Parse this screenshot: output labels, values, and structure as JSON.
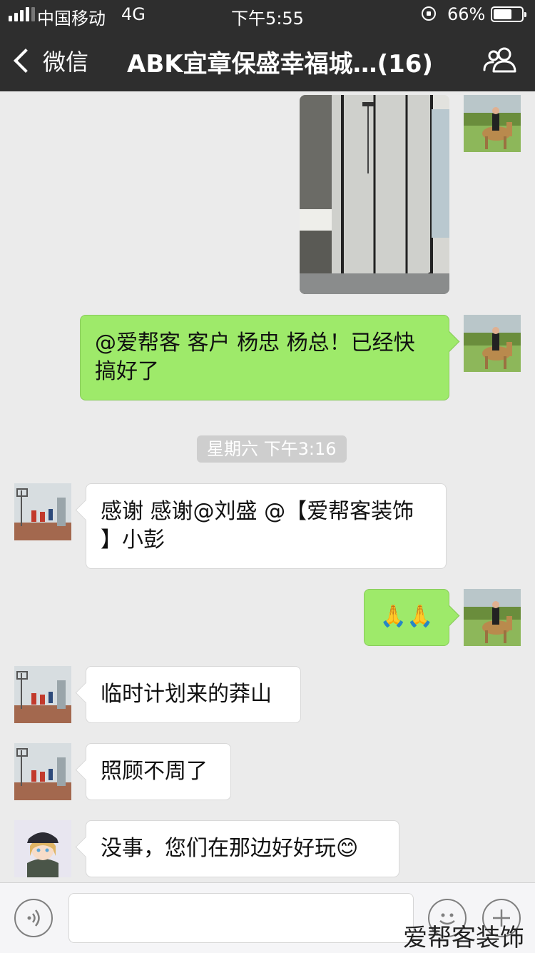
{
  "status_bar": {
    "carrier": "中国移动",
    "network": "4G",
    "time": "下午5:55",
    "battery_percent": "66%",
    "battery_level": 0.66
  },
  "nav": {
    "back_label": "微信",
    "title": "ABK宜章保盛幸福城…(16)"
  },
  "messages": [
    {
      "direction": "out",
      "type": "image",
      "avatar": "horse-rider-avatar",
      "image": "shower-bathroom-photo"
    },
    {
      "direction": "out",
      "type": "text",
      "avatar": "horse-rider-avatar",
      "text": "@爱帮客 客户 杨忠 杨总！已经快搞好了"
    },
    {
      "direction": "out",
      "type": "text",
      "avatar": "horse-rider-avatar",
      "text": "🙏🙏"
    }
  ],
  "texts": {
    "m2": "@爱帮客 客户 杨忠 杨总！已经快",
    "m2b": "搞好了",
    "timestamp": "星期六 下午3:16",
    "m3a": "感谢 感谢@刘盛 @【爱帮客装饰",
    "m3b": "】小彭",
    "m5": "临时计划来的莽山",
    "m6": "照顾不周了",
    "m7": "没事，您们在那边好好玩😊"
  },
  "input": {
    "value": "",
    "placeholder": ""
  },
  "watermark": "爱帮客装饰",
  "colors": {
    "header_bg": "#2e2e2e",
    "chat_bg": "#ebebeb",
    "out_bubble": "#9eea6a",
    "in_bubble": "#ffffff"
  }
}
